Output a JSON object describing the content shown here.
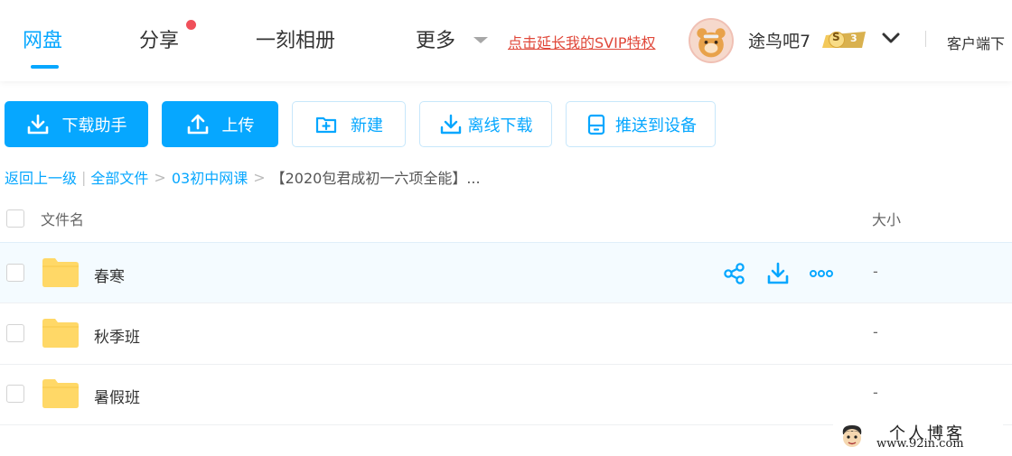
{
  "nav": {
    "tabs": [
      "网盘",
      "分享",
      "一刻相册",
      "更多"
    ],
    "svip_link": "点击延长我的SVIP特权",
    "username": "途鸟吧7",
    "vip_badge": {
      "letter": "S",
      "level": "3"
    },
    "client": "客户端下"
  },
  "toolbar": {
    "download_helper": "下载助手",
    "upload": "上传",
    "new": "新建",
    "offline_download": "离线下载",
    "push_device": "推送到设备"
  },
  "breadcrumb": {
    "back": "返回上一级",
    "all_files": "全部文件",
    "folder": "03初中网课",
    "current": "【2020包君成初一六项全能】..."
  },
  "list": {
    "col_name": "文件名",
    "col_size": "大小",
    "rows": [
      {
        "name": "春寒",
        "size": "-"
      },
      {
        "name": "秋季班",
        "size": "-"
      },
      {
        "name": "暑假班",
        "size": "-"
      }
    ]
  },
  "watermark": {
    "text": "个人博客",
    "url": "www.92in.com"
  },
  "colors": {
    "accent": "#06a7ff",
    "svip_red": "#e0483a",
    "folder_yellow": "#ffd867",
    "badge_gold": "#f3c95b"
  },
  "icons": [
    "download-icon",
    "upload-icon",
    "new-folder-icon",
    "offline-download-icon",
    "push-device-icon",
    "share-icon",
    "more-icon",
    "folder-icon",
    "chevron-down-icon"
  ]
}
